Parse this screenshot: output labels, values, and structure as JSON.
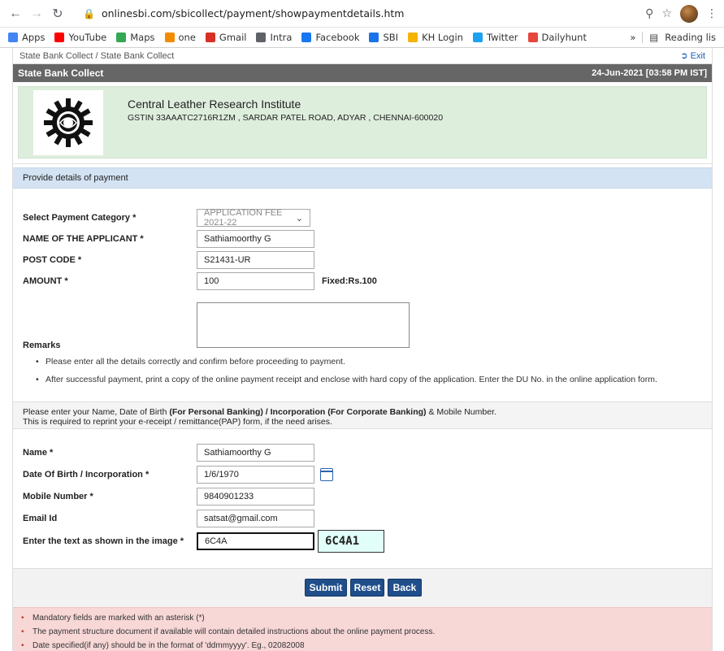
{
  "browser": {
    "url": "onlinesbi.com/sbicollect/payment/showpaymentdetails.htm",
    "bookmarks": [
      {
        "label": "Apps",
        "icon": "apps-grid-icon",
        "color": "#4285f4"
      },
      {
        "label": "YouTube",
        "icon": "youtube-icon",
        "color": "#ff0000"
      },
      {
        "label": "Maps",
        "icon": "maps-pin-icon",
        "color": "#34a853"
      },
      {
        "label": "one",
        "icon": "one-icon",
        "color": "#f28b00"
      },
      {
        "label": "Gmail",
        "icon": "gmail-icon",
        "color": "#d93025"
      },
      {
        "label": "Intra",
        "icon": "globe-icon",
        "color": "#5f6368"
      },
      {
        "label": "Facebook",
        "icon": "facebook-icon",
        "color": "#1877f2"
      },
      {
        "label": "SBI",
        "icon": "sbi-icon",
        "color": "#1a73e8"
      },
      {
        "label": "KH Login",
        "icon": "kh-icon",
        "color": "#f4b400"
      },
      {
        "label": "Twitter",
        "icon": "twitter-icon",
        "color": "#1da1f2"
      },
      {
        "label": "Dailyhunt",
        "icon": "dailyhunt-icon",
        "color": "#e8453c"
      }
    ],
    "overflow": "»",
    "reading_list": "Reading lis"
  },
  "header": {
    "breadcrumb": "State Bank Collect / State Bank Collect",
    "exit": "Exit",
    "title": "State Bank Collect",
    "datetime": "24-Jun-2021 [03:58 PM IST]"
  },
  "institute": {
    "name": "Central Leather Research Institute",
    "address": "GSTIN 33AAATC2716R1ZM , SARDAR PATEL ROAD, ADYAR , CHENNAI-600020"
  },
  "payment": {
    "section_title": "Provide details of payment",
    "category_label": "Select Payment Category *",
    "category_value": "APPLICATION FEE 2021-22",
    "applicant_label": "NAME OF THE APPLICANT *",
    "applicant_value": "Sathiamoorthy G",
    "post_label": "POST CODE *",
    "post_value": "S21431-UR",
    "amount_label": "AMOUNT *",
    "amount_value": "100",
    "amount_note": "Fixed:Rs.100",
    "remarks_label": "Remarks",
    "notes": [
      "Please enter all the details correctly and confirm before proceeding to payment.",
      "After successful payment, print a copy of the online payment receipt and enclose with hard copy of the application. Enter the DU No. in the online application form."
    ]
  },
  "personal": {
    "info_pre": "Please enter your Name, Date of Birth ",
    "info_bold1": "(For Personal Banking) / Incorporation (For Corporate Banking)",
    "info_post": "  & Mobile Number.",
    "info_line2": "This is required to reprint your e-receipt / remittance(PAP) form, if the need arises.",
    "name_label": "Name *",
    "name_value": "Sathiamoorthy G",
    "dob_label": "Date Of Birth / Incorporation *",
    "dob_value": "1/6/1970",
    "mobile_label": "Mobile Number *",
    "mobile_value": "9840901233",
    "email_label": "Email Id",
    "email_value": "satsat@gmail.com",
    "captcha_label": "Enter the text as shown in the image *",
    "captcha_input": "6C4A",
    "captcha_image": "6C4A1"
  },
  "actions": {
    "submit": "Submit",
    "reset": "Reset",
    "back": "Back"
  },
  "footer_notes": [
    "Mandatory fields are marked with an asterisk (*)",
    "The payment structure document if available will contain detailed instructions about the online payment process.",
    "Date specified(if any) should be in the format of 'ddmmyyyy'. Eg., 02082008"
  ]
}
